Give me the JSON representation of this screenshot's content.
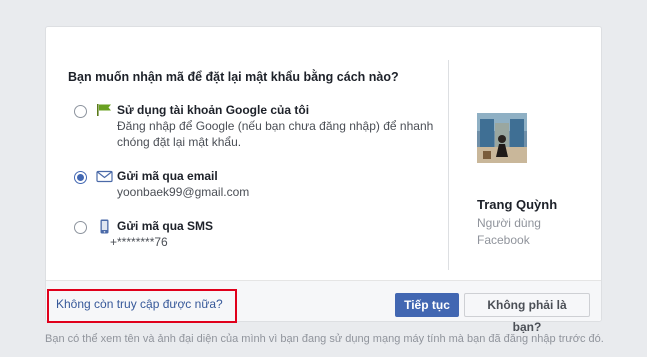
{
  "dialog": {
    "question": "Bạn muốn nhận mã để đặt lại mật khẩu bằng cách nào?",
    "options": [
      {
        "icon": "google-flag-icon",
        "title": "Sử dụng tài khoản Google của tôi",
        "desc_line1": "Đăng nhập để Google (nếu bạn chưa đăng nhập) để nhanh",
        "desc_line2": "chóng đặt lại mật khẩu.",
        "selected": false
      },
      {
        "icon": "envelope-icon",
        "title": "Gửi mã qua email",
        "desc_line1": "yoonbaek99@gmail.com",
        "selected": true
      },
      {
        "icon": "phone-icon",
        "title": "Gửi mã qua SMS",
        "desc_line1": "+********76",
        "selected": false
      }
    ],
    "profile": {
      "name": "Trang Quỳnh",
      "sub_line1": "Người dùng",
      "sub_line2": "Facebook"
    },
    "footer": {
      "link": "Không còn truy cập được nữa?",
      "continue_label": "Tiếp tục",
      "not_you_label": "Không phải là bạn?"
    }
  },
  "note": "Bạn có thể xem tên và ảnh đại diện của mình vì bạn đang sử dụng mạng máy tính mà bạn đã đăng nhập trước đó.",
  "colors": {
    "primary": "#4267b2",
    "link": "#365899",
    "highlight_box": "#e0001b"
  }
}
